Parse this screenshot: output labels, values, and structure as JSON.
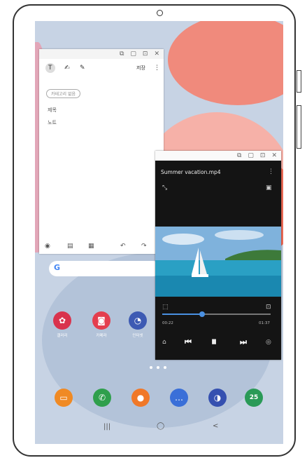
{
  "notes": {
    "toolbar": {
      "text_tool": "T",
      "pen_tool": "✍",
      "brush_tool": "✎",
      "save_label": "저장",
      "more": "⋮"
    },
    "category_chip": "카테고리 없음",
    "title_placeholder": "제목",
    "body_placeholder": "노트",
    "bottom_tools": [
      "◉",
      "▤",
      "▦",
      "↶",
      "↷"
    ]
  },
  "window_bar_icons": [
    "⧉",
    "▢",
    "⊡",
    "✕"
  ],
  "video": {
    "filename": "Summer vacation.mp4",
    "more": "⋮",
    "elapsed": "00:22",
    "total": "01:37",
    "progress": 0.37,
    "controls": {
      "prev": "⏮",
      "pause": "⏸",
      "next": "⏭"
    }
  },
  "search": {
    "logo": "G"
  },
  "apps_row": [
    {
      "label": "갤러리",
      "color": "#d9334d",
      "glyph": "✿"
    },
    {
      "label": "카메라",
      "color": "#e43e4e",
      "glyph": "◙"
    },
    {
      "label": "인터넷",
      "color": "#3d5ab3",
      "glyph": "◔"
    }
  ],
  "dock": [
    {
      "color": "#f08a24",
      "glyph": "▭"
    },
    {
      "color": "#2f9f4c",
      "glyph": "✆"
    },
    {
      "color": "#f07828",
      "glyph": "●"
    },
    {
      "color": "#3a6fd8",
      "glyph": "…"
    },
    {
      "color": "#3550b0",
      "glyph": "◑"
    },
    {
      "color": "#2a9a57",
      "glyph": "25"
    }
  ],
  "nav": {
    "recents": "|||",
    "home": "◯",
    "back": "<"
  }
}
